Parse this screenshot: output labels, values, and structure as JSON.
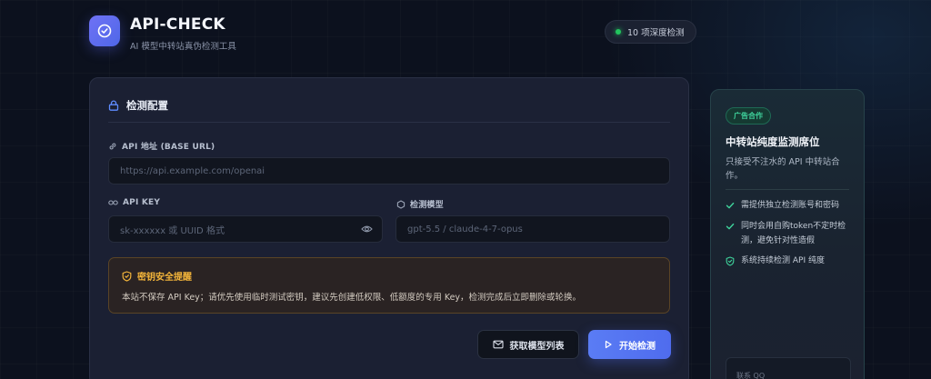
{
  "header": {
    "app_title": "API-CHECK",
    "app_subtitle": "AI 模型中转站真伪检测工具",
    "badge_label": "10 项深度检测"
  },
  "config": {
    "title": "检测配置",
    "base_url": {
      "label": "API 地址 (BASE URL)",
      "placeholder": "https://api.example.com/openai",
      "value": ""
    },
    "api_key": {
      "label": "API KEY",
      "placeholder": "sk-xxxxxx 或 UUID 格式",
      "value": ""
    },
    "model": {
      "label": "检测模型",
      "placeholder": "gpt-5.5 / claude-4-7-opus",
      "value": ""
    },
    "warning": {
      "title": "密钥安全提醒",
      "text": "本站不保存 API Key；请优先使用临时测试密钥，建议先创建低权限、低额度的专用 Key，检测完成后立即删除或轮换。"
    },
    "buttons": {
      "fetch_models": "获取模型列表",
      "start": "开始检测"
    }
  },
  "ad": {
    "tag": "广告合作",
    "title": "中转站纯度监测席位",
    "description": "只接受不注水的 API 中转站合作。",
    "items": [
      {
        "text": "需提供独立检测账号和密码",
        "icon": "check-icon"
      },
      {
        "text": "同时会用自购token不定时检测，避免针对性造假",
        "icon": "check-icon"
      },
      {
        "text": "系统持续检测 API 纯度",
        "icon": "shield-check-icon"
      }
    ],
    "contact_label": "联系 QQ"
  },
  "colors": {
    "accent": "#5a7cf4",
    "success": "#22c55e",
    "warning": "#f2b43a",
    "ad_accent": "#3fd39c"
  }
}
